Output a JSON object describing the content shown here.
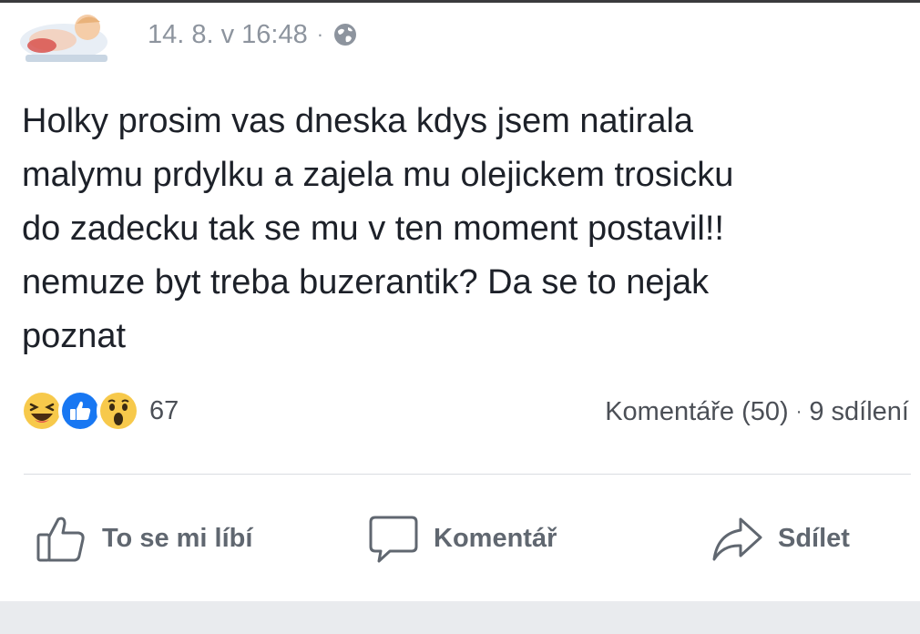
{
  "post": {
    "timestamp": "14. 8. v 16:48",
    "separator": "·",
    "privacy_icon": "globe-icon",
    "text": "Holky prosim vas dneska kdys jsem natirala\nmalymu prdylku a zajela mu olejickem trosicku\ndo zadecku tak se mu v ten moment postavil!!\nnemuze byt treba buzerantik? Da se to nejak\npoznat"
  },
  "reactions": {
    "icons": [
      "haha-icon",
      "like-icon",
      "wow-icon"
    ],
    "count": "67"
  },
  "stats": {
    "comments": "Komentáře (50)",
    "separator": "·",
    "shares": "9 sdílení"
  },
  "actions": {
    "like_label": "To se mi líbí",
    "comment_label": "Komentář",
    "share_label": "Sdílet"
  },
  "colors": {
    "text": "#1d2129",
    "meta": "#8d949e",
    "action": "#606770",
    "like_blue": "#1877f2",
    "reaction_yellow": "#f7c94b"
  }
}
